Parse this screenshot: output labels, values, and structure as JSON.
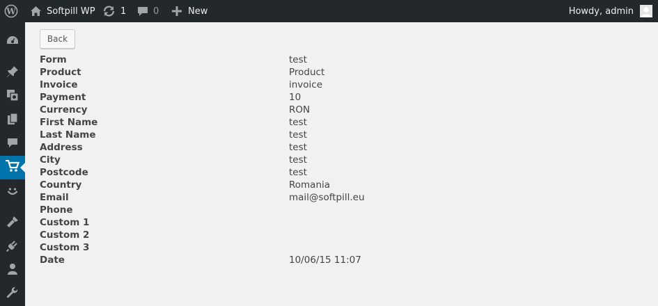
{
  "adminbar": {
    "site_name": "Softpill WP",
    "updates_count": "1",
    "comments_count": "0",
    "new_label": "New",
    "howdy": "Howdy, admin"
  },
  "icons": {
    "wp_logo": "wordpress-logo-icon",
    "home": "home-icon",
    "updates": "updates-icon",
    "comments": "comment-icon",
    "new": "plus-icon",
    "dashboard": "dashboard-icon",
    "posts": "pin-icon",
    "media": "media-icon",
    "pages": "pages-icon",
    "comments_menu": "comment-icon",
    "cart": "cart-icon",
    "appearance": "smiley-icon",
    "brush": "brush-icon",
    "plugins": "plug-icon",
    "users": "user-icon",
    "tools": "wrench-icon"
  },
  "colors": {
    "adminbar_bg": "#23282d",
    "current_menu": "#0073aa",
    "content_bg": "#f1f1f1"
  },
  "back_label": "Back",
  "details": [
    {
      "label": "Form",
      "value": "test"
    },
    {
      "label": "Product",
      "value": "Product"
    },
    {
      "label": "Invoice",
      "value": "invoice"
    },
    {
      "label": "Payment",
      "value": "10"
    },
    {
      "label": "Currency",
      "value": "RON"
    },
    {
      "label": "First Name",
      "value": "test"
    },
    {
      "label": "Last Name",
      "value": "test"
    },
    {
      "label": "Address",
      "value": "test"
    },
    {
      "label": "City",
      "value": "test"
    },
    {
      "label": "Postcode",
      "value": "test"
    },
    {
      "label": "Country",
      "value": "Romania"
    },
    {
      "label": "Email",
      "value": "mail@softpill.eu"
    },
    {
      "label": "Phone",
      "value": ""
    },
    {
      "label": "Custom 1",
      "value": ""
    },
    {
      "label": "Custom 2",
      "value": ""
    },
    {
      "label": "Custom 3",
      "value": ""
    },
    {
      "label": "Date",
      "value": "10/06/15 11:07"
    }
  ]
}
